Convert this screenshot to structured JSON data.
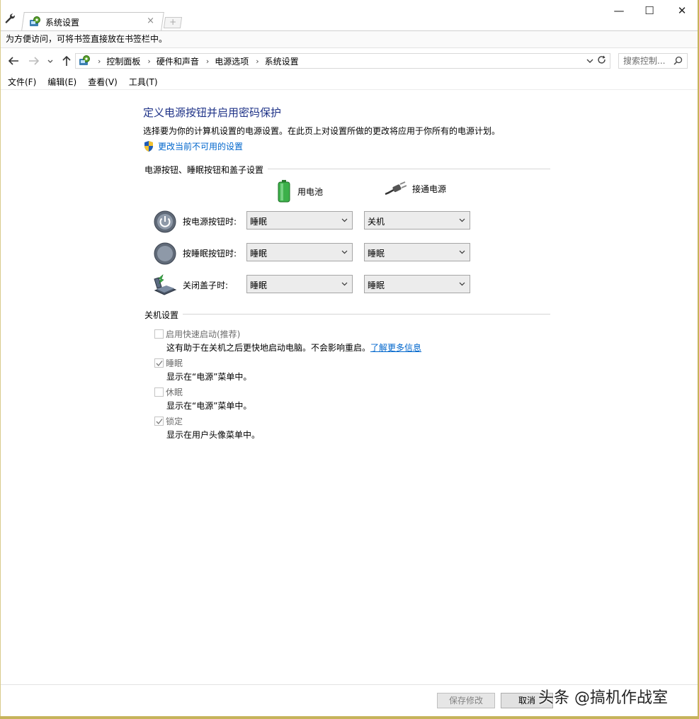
{
  "window": {
    "tab_title": "系统设置",
    "tab_close": "×",
    "newtab": "+",
    "minimize": "—",
    "maximize": "☐",
    "close": "✕"
  },
  "bookmarks_bar": {
    "text": "为方便访问，可将书签直接放在书签栏中。"
  },
  "address": {
    "crumbs": [
      "控制面板",
      "硬件和声音",
      "电源选项",
      "系统设置"
    ],
    "search_placeholder": "搜索控制..."
  },
  "menu": [
    "文件(F)",
    "编辑(E)",
    "查看(V)",
    "工具(T)"
  ],
  "page": {
    "title": "定义电源按钮并启用密码保护",
    "description": "选择要为你的计算机设置的电源设置。在此页上对设置所做的更改将应用于你所有的电源计划。",
    "change_link": "更改当前不可用的设置"
  },
  "power_buttons": {
    "group_title": "电源按钮、睡眠按钮和盖子设置",
    "battery_label": "用电池",
    "plugged_label": "接通电源",
    "rows": [
      {
        "label": "按电源按钮时:",
        "icon": "power-button-icon",
        "battery": "睡眠",
        "plugged": "关机"
      },
      {
        "label": "按睡眠按钮时:",
        "icon": "sleep-button-icon",
        "battery": "睡眠",
        "plugged": "睡眠"
      },
      {
        "label": "关闭盖子时:",
        "icon": "laptop-lid-icon",
        "battery": "睡眠",
        "plugged": "睡眠"
      }
    ]
  },
  "shutdown": {
    "group_title": "关机设置",
    "options": [
      {
        "label": "启用快速启动(推荐)",
        "checked": false,
        "desc": "这有助于在关机之后更快地启动电脑。不会影响重启。",
        "link": "了解更多信息"
      },
      {
        "label": "睡眠",
        "checked": true,
        "desc": "显示在“电源”菜单中。"
      },
      {
        "label": "休眠",
        "checked": false,
        "desc": "显示在“电源”菜单中。"
      },
      {
        "label": "锁定",
        "checked": true,
        "desc": "显示在用户头像菜单中。"
      }
    ]
  },
  "footer": {
    "save": "保存修改",
    "cancel": "取消"
  },
  "watermark": "头条 @搞机作战室",
  "colors": {
    "title": "#1e3287",
    "link": "#0066cc",
    "edge": "#c6b35b"
  }
}
